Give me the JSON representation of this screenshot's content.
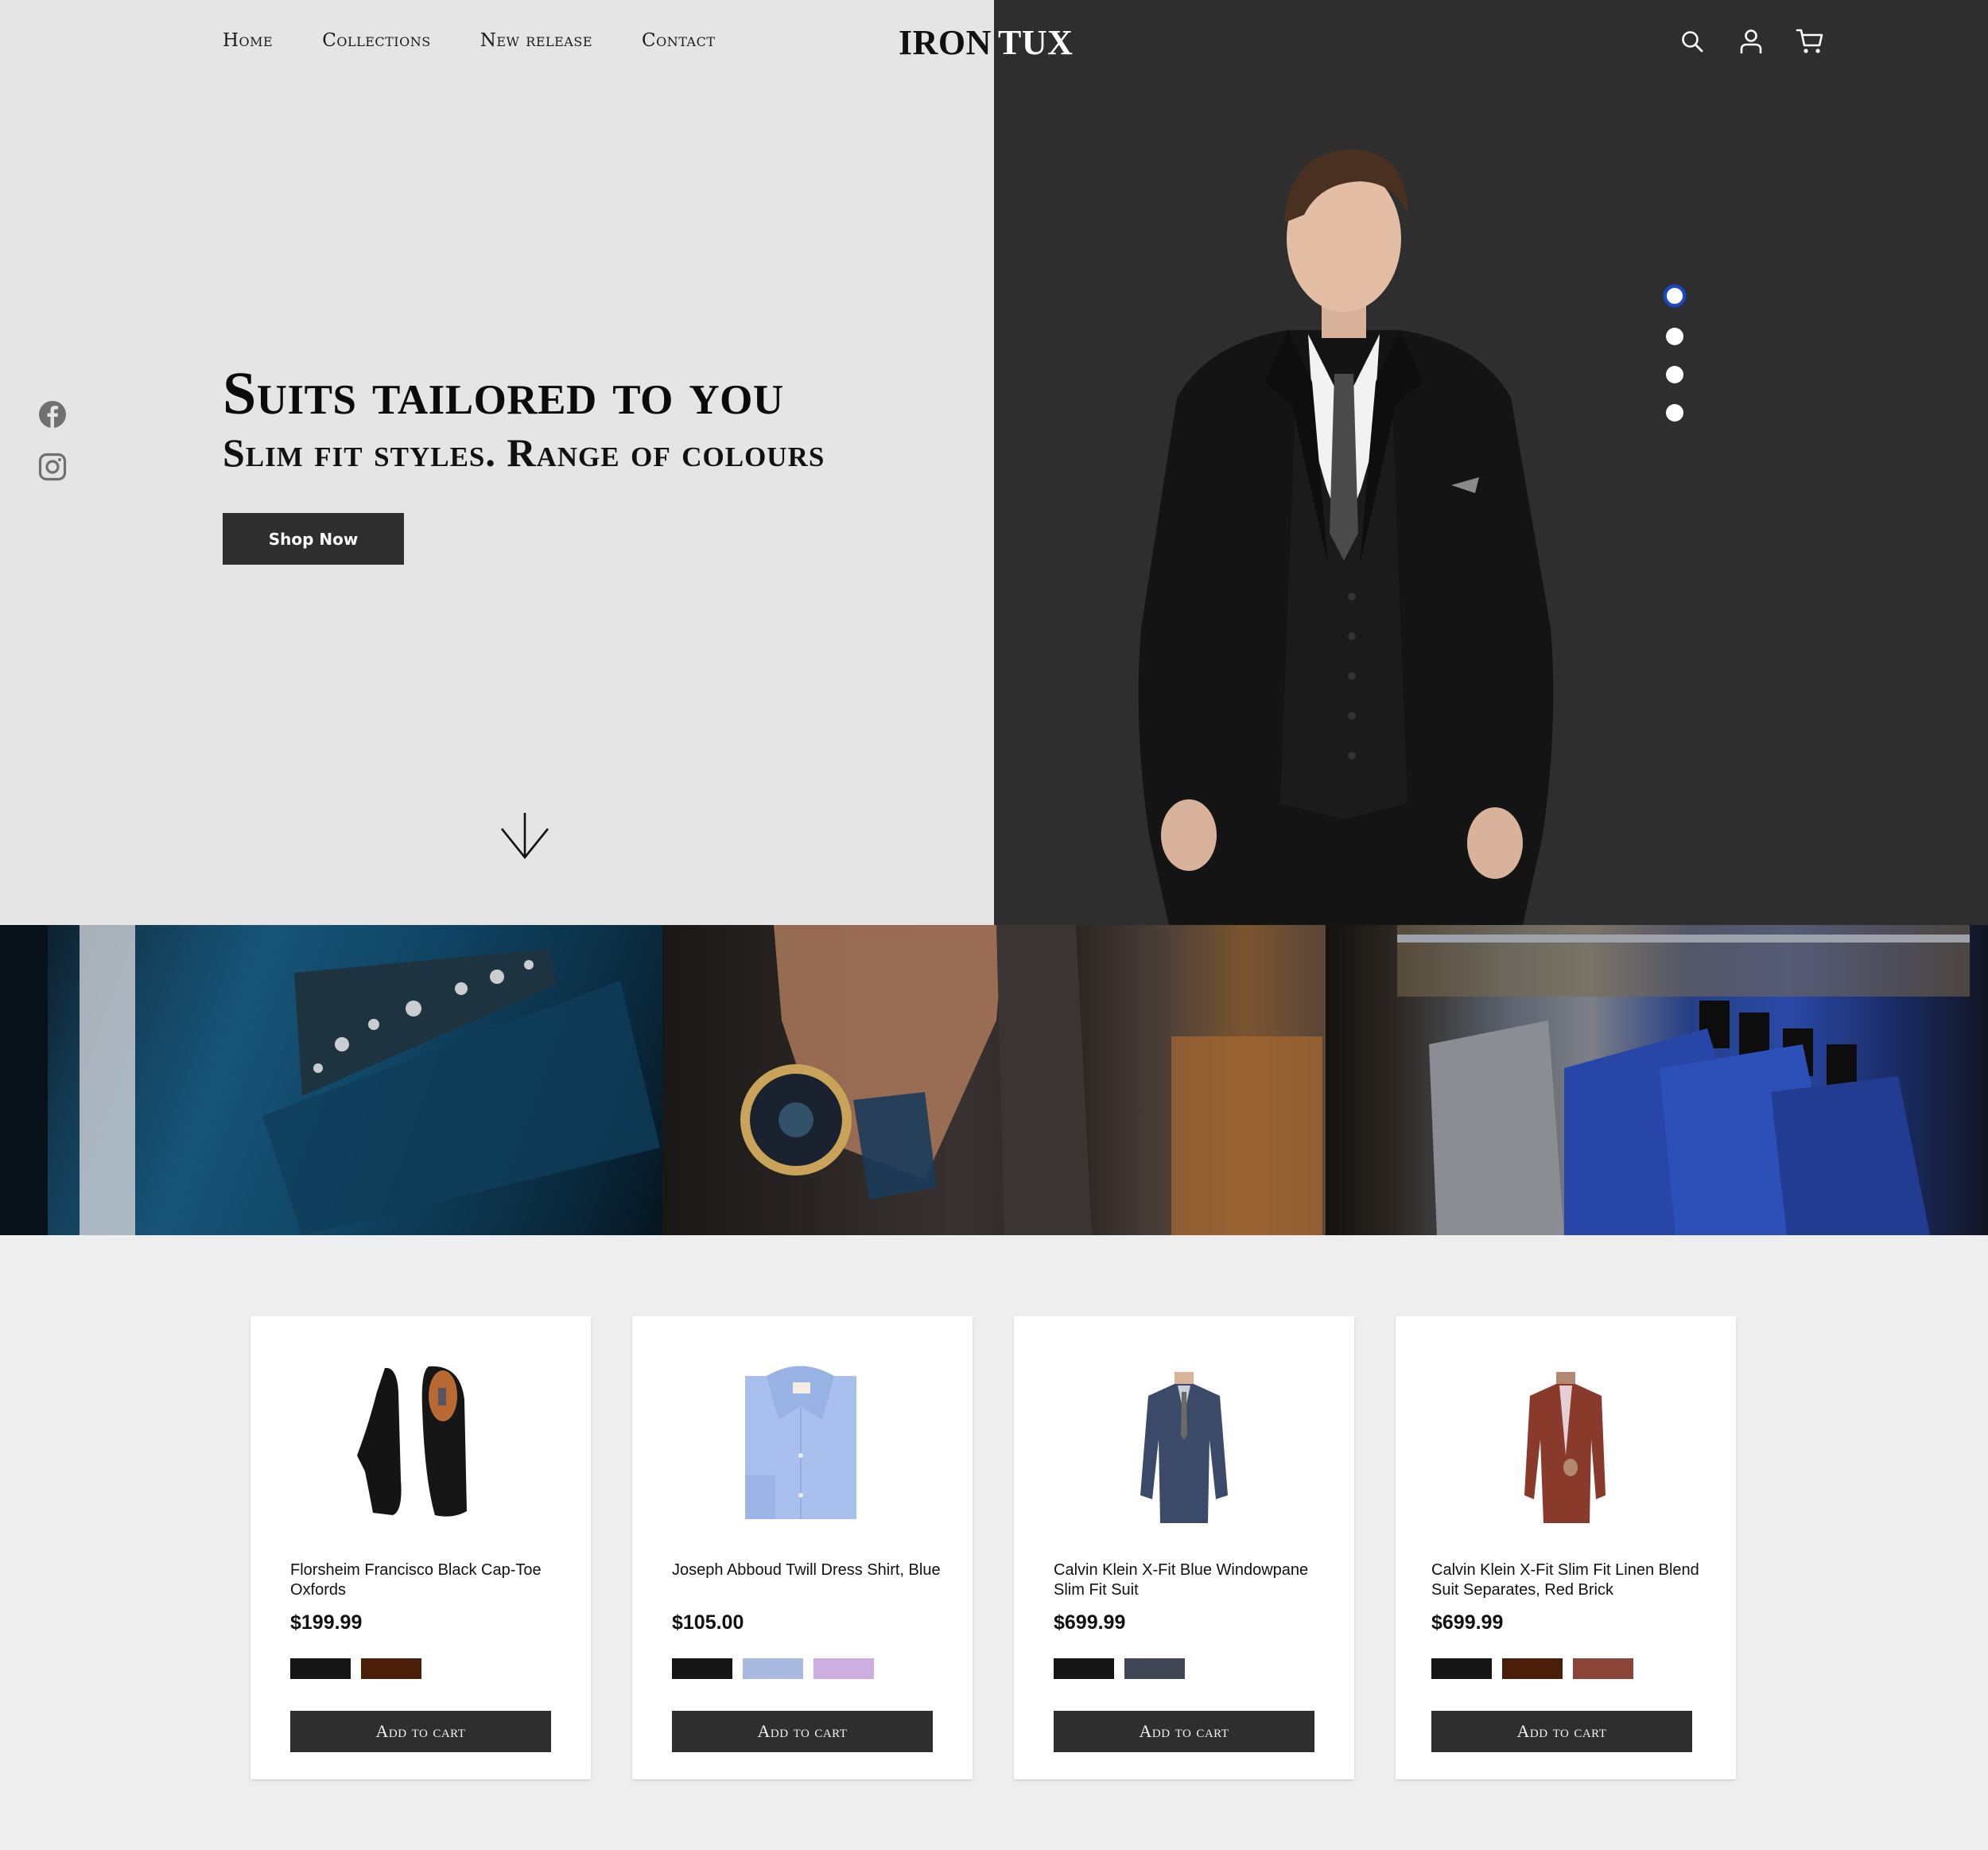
{
  "brand": {
    "part1": "IRON",
    "part2": "TUX"
  },
  "nav": {
    "items": [
      {
        "label": "Home"
      },
      {
        "label": "Collections"
      },
      {
        "label": "New release"
      },
      {
        "label": "Contact"
      }
    ]
  },
  "header_icons": [
    "search-icon",
    "user-icon",
    "cart-icon"
  ],
  "social": [
    "facebook-icon",
    "instagram-icon"
  ],
  "hero": {
    "title": "Suits tailored to you",
    "subtitle": "Slim fit styles. Range of colours",
    "cta_label": "Shop Now",
    "scroll_icon": "arrow-down-icon",
    "slider": {
      "count": 4,
      "active_index": 0,
      "active_color": "#1e4bb8"
    }
  },
  "gallery": [
    {
      "subject": "blue jacket pocket square"
    },
    {
      "subject": "wristwatch on suit sleeve"
    },
    {
      "subject": "suits on hanger rack"
    }
  ],
  "products": [
    {
      "name": "Florsheim Francisco Black Cap-Toe Oxfords",
      "price": "$199.99",
      "image": "black oxford shoes",
      "swatches": [
        "#151515",
        "#4a1e08"
      ],
      "cta": "Add to cart"
    },
    {
      "name": "Joseph Abboud Twill Dress Shirt, Blue",
      "price": "$105.00",
      "image": "folded blue dress shirt",
      "swatches": [
        "#151515",
        "#a8b9e0",
        "#ccaee0"
      ],
      "cta": "Add to cart"
    },
    {
      "name": "Calvin Klein X-Fit Blue Windowpane Slim Fit Suit",
      "price": "$699.99",
      "image": "blue windowpane suit",
      "swatches": [
        "#151515",
        "#3f4656"
      ],
      "cta": "Add to cart"
    },
    {
      "name": "Calvin Klein X-Fit Slim Fit Linen Blend Suit Separates, Red Brick",
      "price": "$699.99",
      "image": "red brick linen suit",
      "swatches": [
        "#151515",
        "#4a1e08",
        "#8a4538"
      ],
      "cta": "Add to cart"
    }
  ],
  "colors": {
    "hero_left_bg": "#e5e5e5",
    "hero_right_bg": "#2e2e2e",
    "button_bg": "#2e2e2e",
    "page_bg": "#eeeeee"
  }
}
